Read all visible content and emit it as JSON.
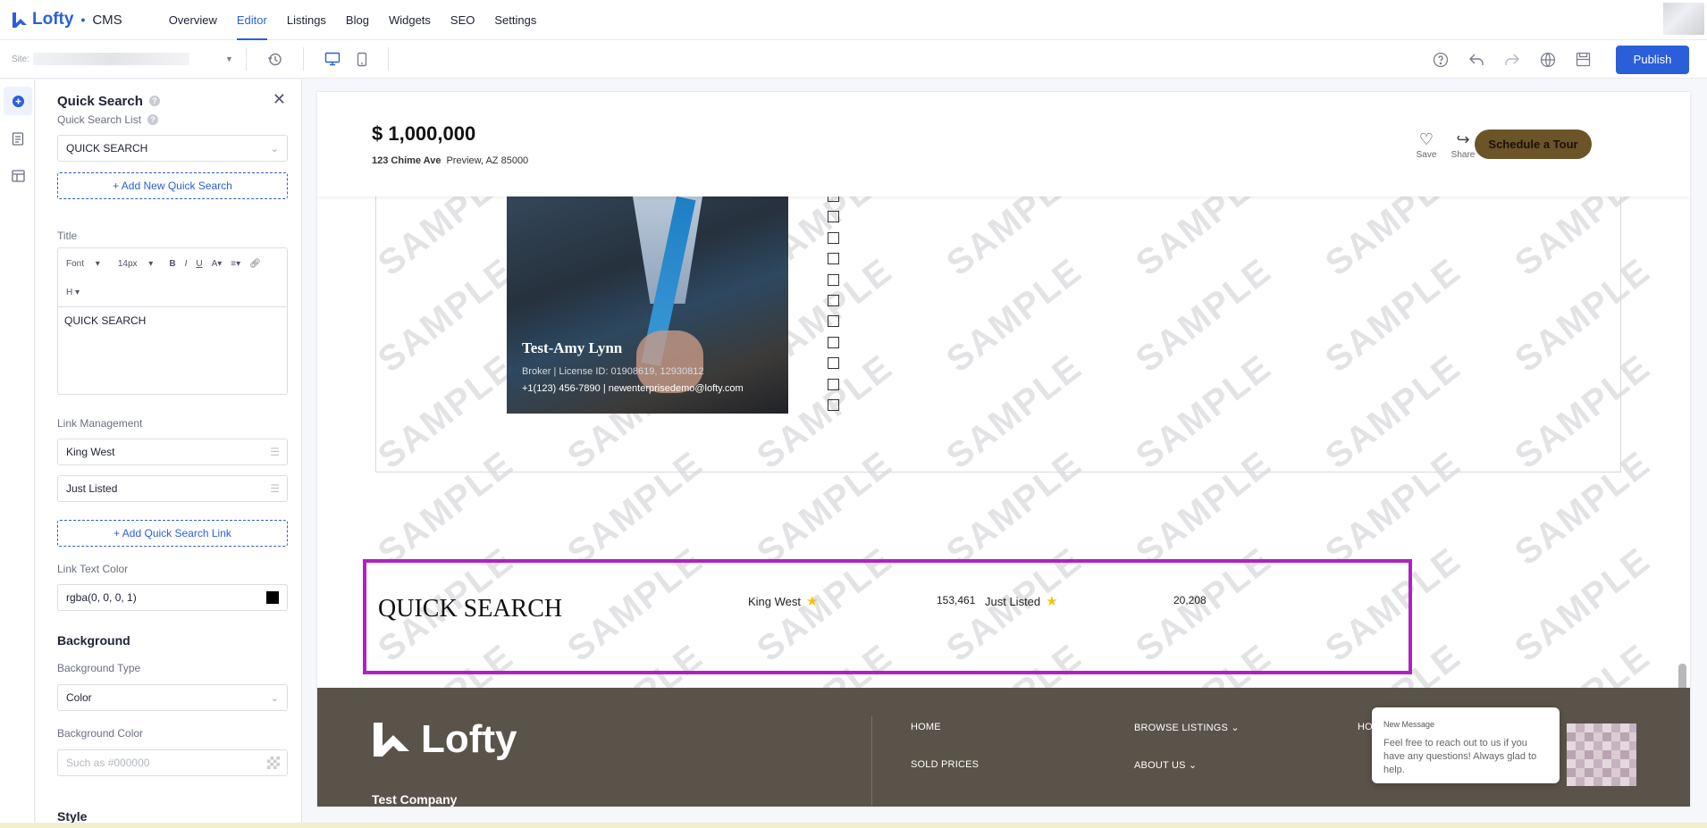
{
  "app": {
    "brand": "Lofty",
    "product": "CMS",
    "nav": [
      "Overview",
      "Editor",
      "Listings",
      "Blog",
      "Widgets",
      "SEO",
      "Settings"
    ],
    "active_nav": "Editor"
  },
  "toolbar": {
    "site_label": "Site:",
    "publish_label": "Publish"
  },
  "panel": {
    "title": "Quick Search",
    "list_label": "Quick Search List",
    "list_value": "QUICK SEARCH",
    "add_new_label": "+ Add New Quick Search",
    "title_label": "Title",
    "editor_font": "Font",
    "editor_size": "14px",
    "editor_heading": "H",
    "title_value": "QUICK SEARCH",
    "link_mgmt_label": "Link Management",
    "links": [
      "King West",
      "Just Listed"
    ],
    "add_link_label": "+ Add Quick Search Link",
    "link_color_label": "Link Text Color",
    "link_color_value": "rgba(0, 0, 0, 1)",
    "background_section": "Background",
    "bg_type_label": "Background Type",
    "bg_type_value": "Color",
    "bg_color_label": "Background Color",
    "bg_color_placeholder": "Such as #000000",
    "style_section": "Style"
  },
  "preview": {
    "price": "$ 1,000,000",
    "address_street": "123 Chime Ave",
    "address_city": "Preview, AZ 85000",
    "save_label": "Save",
    "share_label": "Share",
    "tour_label": "Schedule a Tour",
    "watermark": "SAMPLE",
    "agent_name": "Test-Amy Lynn",
    "agent_license": "Broker | License ID: 01908619, 12930812",
    "agent_contact": "+1(123) 456-7890 | newenterprisedemo@lofty.com",
    "quick_search_title": "QUICK SEARCH",
    "quick_links": [
      {
        "label": "King West",
        "count": "153,461"
      },
      {
        "label": "Just Listed",
        "count": "20,208"
      }
    ],
    "footer": {
      "logo_text": "Lofty",
      "company": "Test Company",
      "links": [
        "HOME",
        "SOLD PRICES",
        "BROWSE LISTINGS",
        "ABOUT US",
        "HO"
      ]
    },
    "chat": {
      "title": "New Message",
      "body": "Feel free to reach out to us if you have any questions! Always glad to help."
    }
  }
}
